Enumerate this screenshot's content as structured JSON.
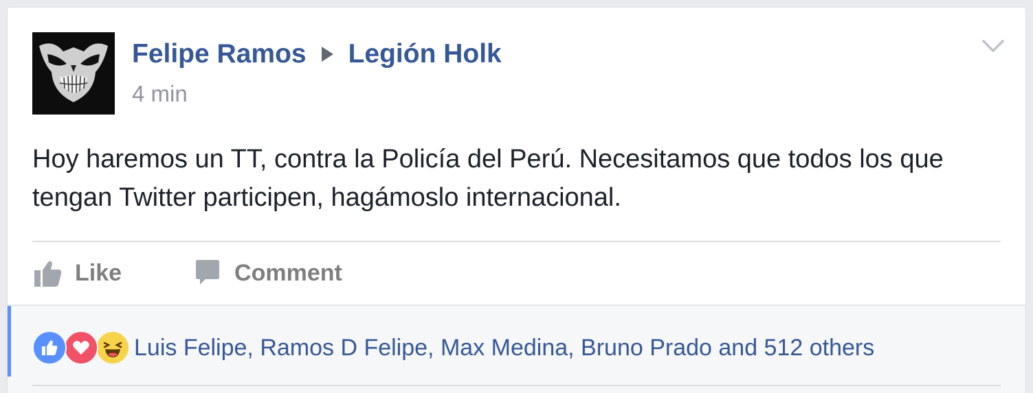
{
  "post": {
    "author": "Felipe Ramos",
    "group": "Legión Holk",
    "timestamp": "4 min",
    "text": "Hoy haremos un TT, contra la Policía del Perú. Necesitamos que todos los que tengan Twitter participen, hagámoslo internacional.",
    "avatar_icon": "skull-mask-avatar",
    "options_icon": "chevron-down-icon"
  },
  "actions": {
    "like_label": "Like",
    "comment_label": "Comment"
  },
  "reactions": {
    "types": [
      "like",
      "love",
      "haha"
    ],
    "names_text": "Luis Felipe, Ramos D Felipe, Max Medina, Bruno Prado and 512 others"
  },
  "colors": {
    "link_blue": "#365899",
    "like_blue": "#5890ff",
    "love_red": "#f25268",
    "haha_yellow": "#f7d34a"
  }
}
